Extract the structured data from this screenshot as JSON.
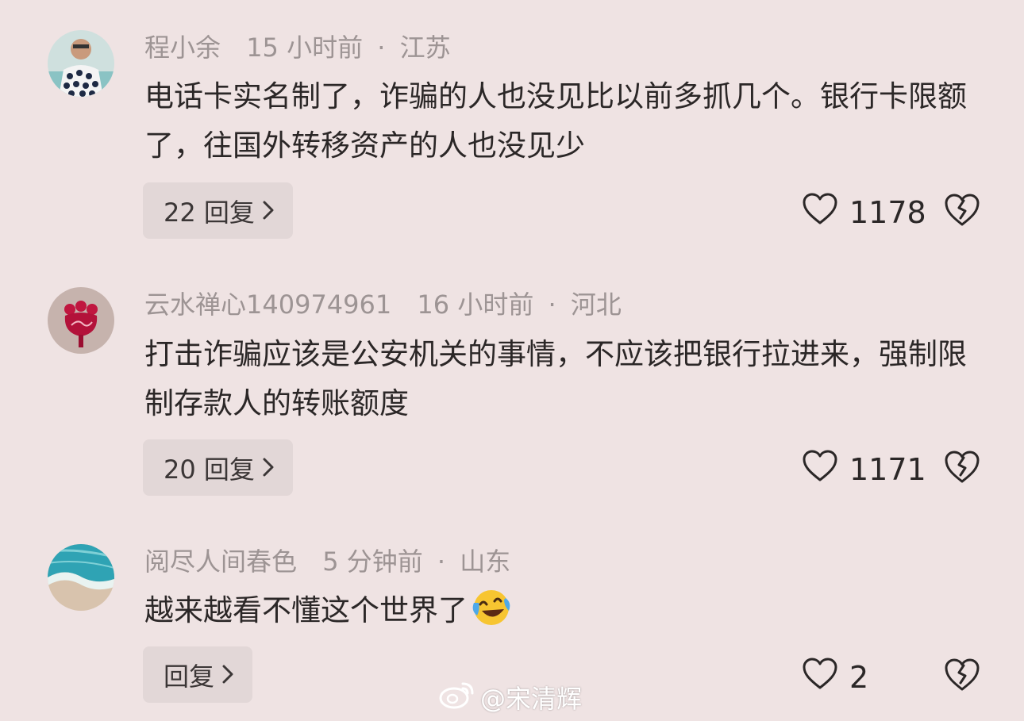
{
  "comments": [
    {
      "username": "程小余",
      "time": "15 小时前",
      "separator": "·",
      "location": "江苏",
      "text": "电话卡实名制了，诈骗的人也没见比以前多抓几个。银行卡限额了，往国外转移资产的人也没见少",
      "reply_label": "22 回复",
      "likes": "1178",
      "avatar_icon": "person-photo-avatar"
    },
    {
      "username": "云水禅心140974961",
      "time": "16 小时前",
      "separator": "·",
      "location": "河北",
      "text": "打击诈骗应该是公安机关的事情，不应该把银行拉进来，强制限制存款人的转账额度",
      "reply_label": "20 回复",
      "likes": "1171",
      "avatar_icon": "flower-avatar"
    },
    {
      "username": "阅尽人间春色",
      "time": "5 分钟前",
      "separator": "·",
      "location": "山东",
      "text": "越来越看不懂这个世界了",
      "emoji": "laughing-crying-emoji",
      "reply_label": "回复",
      "likes": "2",
      "avatar_icon": "beach-avatar"
    }
  ],
  "watermark": {
    "text": "@宋清辉",
    "icon": "weibo-logo"
  },
  "colors": {
    "background": "#efe3e3",
    "reply_button_bg": "#e2d7d7",
    "meta_text": "#9d9494",
    "body_text": "#2b2727"
  }
}
